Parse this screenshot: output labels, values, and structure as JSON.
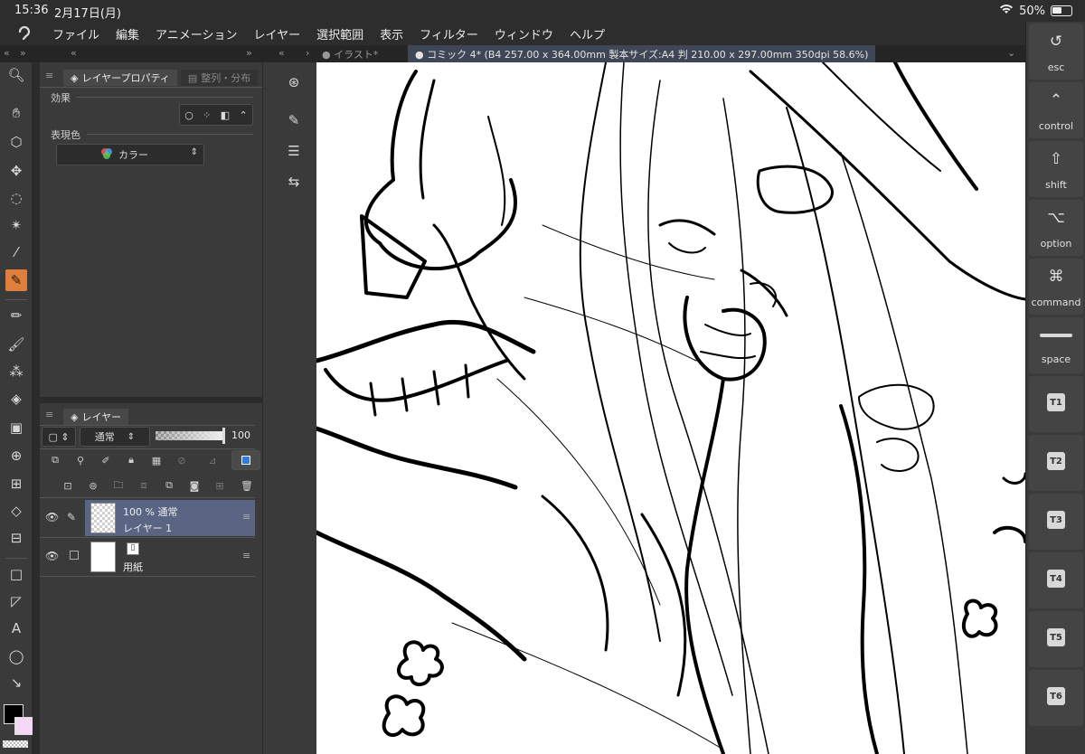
{
  "status": {
    "time": "15:36",
    "date": "2月17日(月)",
    "battery": "50%"
  },
  "menu": {
    "items": [
      "ファイル",
      "編集",
      "アニメーション",
      "レイヤー",
      "選択範囲",
      "表示",
      "フィルター",
      "ウィンドウ",
      "ヘルプ"
    ]
  },
  "tabs": {
    "inactive": "● イラスト*",
    "active": "● コミック 4* (B4 257.00 x 364.00mm 製本サイズ:A4 判 210.00 x 297.00mm 350dpi 58.6%)"
  },
  "properties": {
    "tab_label": "レイヤープロパティ",
    "tab2_label": "整列・分布",
    "effect_label": "効果",
    "expression_label": "表現色",
    "expression_value": "カラー"
  },
  "layers": {
    "tab_label": "レイヤー",
    "blend_mode": "通常",
    "opacity": "100",
    "rows": [
      {
        "info": "100 % 通常",
        "name": "レイヤー 1"
      },
      {
        "info": "",
        "name": "用紙"
      }
    ]
  },
  "shortcuts": [
    {
      "label": "esc"
    },
    {
      "label": "control"
    },
    {
      "label": "shift"
    },
    {
      "label": "option"
    },
    {
      "label": "command"
    },
    {
      "label": "space"
    },
    {
      "label": "T1"
    },
    {
      "label": "T2"
    },
    {
      "label": "T3"
    },
    {
      "label": "T4"
    },
    {
      "label": "T5"
    },
    {
      "label": "T6"
    }
  ],
  "colors": {
    "accent": "#e07f3c",
    "selected_layer": "#5a6583",
    "panel": "#3a3a3a"
  }
}
